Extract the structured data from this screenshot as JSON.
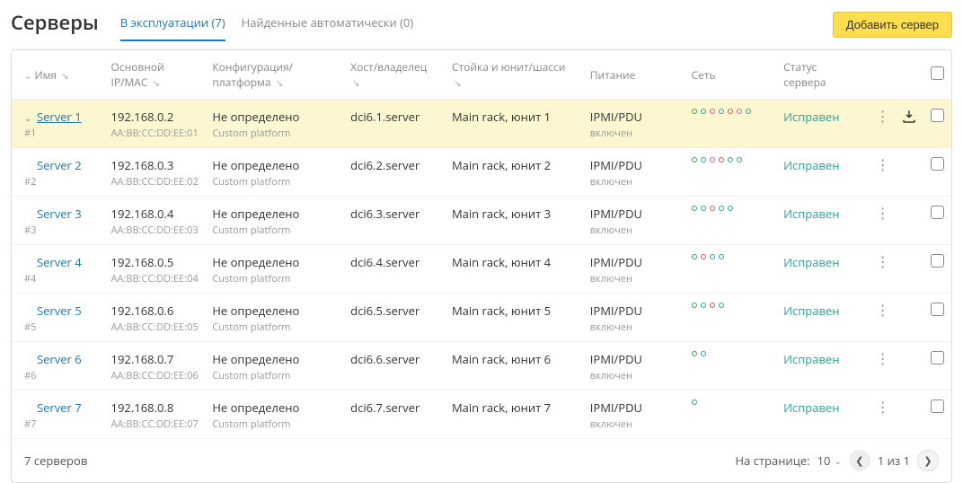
{
  "title": "Серверы",
  "tabs": {
    "active": "В эксплуатации (7)",
    "inactive": "Найденные автоматически (0)"
  },
  "add_button": "Добавить сервер",
  "columns": {
    "name": "Имя",
    "ip": "Основной IP/MAC",
    "conf": "Конфигурация/платформа",
    "host": "Хост/владелец",
    "rack": "Стойка и юнит/шасси",
    "power": "Питание",
    "net": "Сеть",
    "status": "Статус сервера"
  },
  "sort_glyph": "↘",
  "rows": [
    {
      "selected": true,
      "chev": true,
      "name": "Server 1",
      "id": "#1",
      "ip": "192.168.0.2",
      "mac": "AA:BB:CC:DD:EE:01",
      "conf": "Не определено",
      "platform": "Custom platform",
      "host": "dci6.1.server",
      "rack": "Main rack, юнит 1",
      "power": "IPMI/PDU",
      "power_state": "включен",
      "status": "Исправен",
      "net": [
        "g",
        "t",
        "p",
        "t",
        "r",
        "p",
        "t"
      ]
    },
    {
      "selected": false,
      "chev": false,
      "name": "Server 2",
      "id": "#2",
      "ip": "192.168.0.3",
      "mac": "AA:BB:CC:DD:EE:02",
      "conf": "Не определено",
      "platform": "Custom platform",
      "host": "dci6.2.server",
      "rack": "Main rack, юнит 2",
      "power": "IPMI/PDU",
      "power_state": "включен",
      "status": "Исправен",
      "net": [
        "g",
        "t",
        "p",
        "r",
        "t",
        "t"
      ]
    },
    {
      "selected": false,
      "chev": false,
      "name": "Server 3",
      "id": "#3",
      "ip": "192.168.0.4",
      "mac": "AA:BB:CC:DD:EE:03",
      "conf": "Не определено",
      "platform": "Custom platform",
      "host": "dci6.3.server",
      "rack": "Main rack, юнит 3",
      "power": "IPMI/PDU",
      "power_state": "включен",
      "status": "Исправен",
      "net": [
        "g",
        "t",
        "r",
        "t",
        "t"
      ]
    },
    {
      "selected": false,
      "chev": false,
      "name": "Server 4",
      "id": "#4",
      "ip": "192.168.0.5",
      "mac": "AA:BB:CC:DD:EE:04",
      "conf": "Не определено",
      "platform": "Custom platform",
      "host": "dci6.4.server",
      "rack": "Main rack, юнит 4",
      "power": "IPMI/PDU",
      "power_state": "включен",
      "status": "Исправен",
      "net": [
        "g",
        "r",
        "t",
        "t"
      ]
    },
    {
      "selected": false,
      "chev": false,
      "name": "Server 5",
      "id": "#5",
      "ip": "192.168.0.6",
      "mac": "AA:BB:CC:DD:EE:05",
      "conf": "Не определено",
      "platform": "Custom platform",
      "host": "dci6.5.server",
      "rack": "Main rack, юнит 5",
      "power": "IPMI/PDU",
      "power_state": "включен",
      "status": "Исправен",
      "net": [
        "g",
        "t",
        "r",
        "t"
      ]
    },
    {
      "selected": false,
      "chev": false,
      "name": "Server 6",
      "id": "#6",
      "ip": "192.168.0.7",
      "mac": "AA:BB:CC:DD:EE:06",
      "conf": "Не определено",
      "platform": "Custom platform",
      "host": "dci6.6.server",
      "rack": "Main rack, юнит 6",
      "power": "IPMI/PDU",
      "power_state": "включен",
      "status": "Исправен",
      "net": [
        "g",
        "t"
      ]
    },
    {
      "selected": false,
      "chev": false,
      "name": "Server 7",
      "id": "#7",
      "ip": "192.168.0.8",
      "mac": "AA:BB:CC:DD:EE:07",
      "conf": "Не определено",
      "platform": "Custom platform",
      "host": "dci6.7.server",
      "rack": "Main rack, юнит 7",
      "power": "IPMI/PDU",
      "power_state": "включен",
      "status": "Исправен",
      "net": [
        "t"
      ]
    }
  ],
  "footer": {
    "count": "7 серверов",
    "per_page_label": "На странице:",
    "per_page_value": "10",
    "page_text": "1 из 1"
  }
}
